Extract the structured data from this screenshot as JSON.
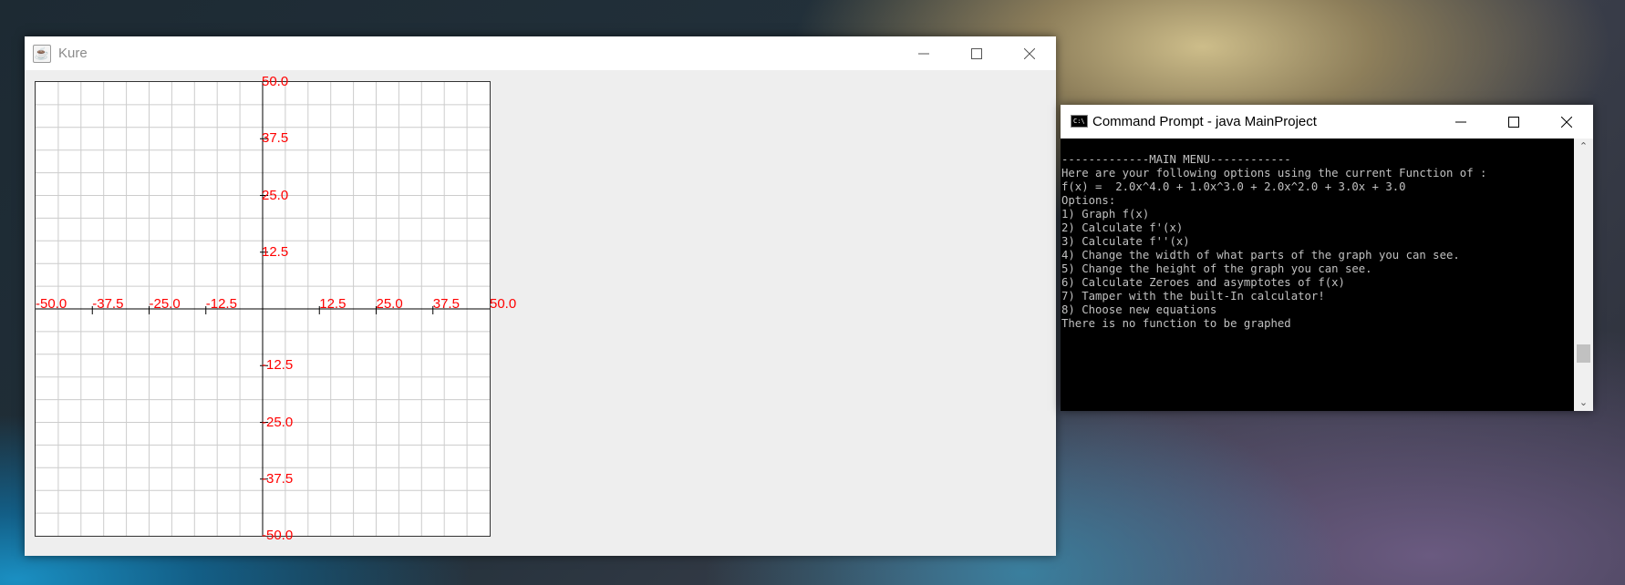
{
  "kure_window": {
    "title": "Kure",
    "controls": [
      "minimize",
      "maximize",
      "close"
    ],
    "graph": {
      "x_range": [
        -50.0,
        50.0
      ],
      "y_range": [
        -50.0,
        50.0
      ],
      "grid_lines_per_axis": 20,
      "label_color": "#ff0000",
      "x_tick_labels": [
        "-50.0",
        "-37.5",
        "-25.0",
        "-12.5",
        "12.5",
        "25.0",
        "37.5",
        "50.0"
      ],
      "y_tick_labels": [
        "50.0",
        "37.5",
        "25.0",
        "12.5",
        "-12.5",
        "-25.0",
        "-37.5",
        "-50.0"
      ]
    }
  },
  "cmd_window": {
    "title": "Command Prompt - java  MainProject",
    "lines": [
      "-------------MAIN MENU------------",
      "Here are your following options using the current Function of :",
      "f(x) =  2.0x^4.0 + 1.0x^3.0 + 2.0x^2.0 + 3.0x + 3.0",
      "Options:",
      "1) Graph f(x)",
      "2) Calculate f'(x)",
      "3) Calculate f''(x)",
      "4) Change the width of what parts of the graph you can see.",
      "5) Change the height of the graph you can see.",
      "6) Calculate Zeroes and asymptotes of f(x)",
      "7) Tamper with the built-In calculator!",
      "8) Choose new equations",
      "There is no function to be graphed"
    ]
  }
}
